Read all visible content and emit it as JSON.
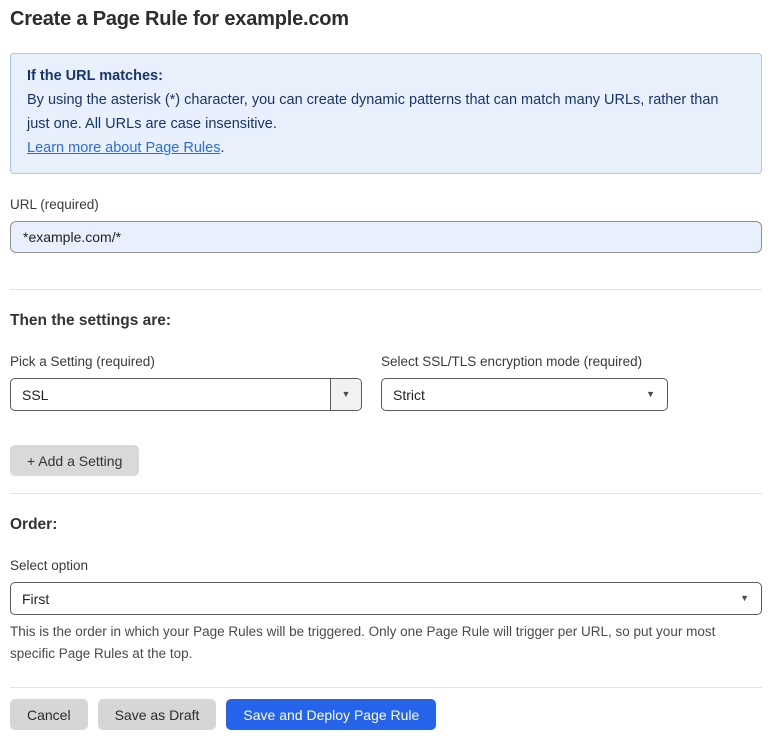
{
  "page": {
    "title": "Create a Page Rule for example.com"
  },
  "info_box": {
    "heading": "If the URL matches:",
    "body": "By using the asterisk (*) character, you can create dynamic patterns that can match many URLs, rather than just one. All URLs are case insensitive.",
    "link_label": "Learn more about Page Rules",
    "link_suffix": "."
  },
  "url_field": {
    "label": "URL (required)",
    "value": "*example.com/*"
  },
  "settings_section": {
    "heading": "Then the settings are:",
    "setting_picker": {
      "label": "Pick a Setting (required)",
      "value": "SSL"
    },
    "ssl_mode_picker": {
      "label": "Select SSL/TLS encryption mode (required)",
      "value": "Strict"
    },
    "add_setting_label": "+ Add a Setting"
  },
  "order_section": {
    "heading": "Order:",
    "select_label": "Select option",
    "value": "First",
    "help_text": "This is the order in which your Page Rules will be triggered. Only one Page Rule will trigger per URL, so put your most specific Page Rules at the top."
  },
  "footer": {
    "cancel_label": "Cancel",
    "save_draft_label": "Save as Draft",
    "save_deploy_label": "Save and Deploy Page Rule"
  },
  "icons": {
    "dropdown_arrow": "▼"
  },
  "colors": {
    "primary_blue": "#2563eb",
    "info_bg": "#e8f1fb",
    "info_border": "#a9c9ee",
    "info_text": "#17356b",
    "link_blue": "#2c6cdf",
    "input_autofill_bg": "#e8f0fe",
    "gray_button_bg": "#d6d6d6",
    "select_border": "#5a5a5a",
    "divider": "#e3e3e3"
  }
}
